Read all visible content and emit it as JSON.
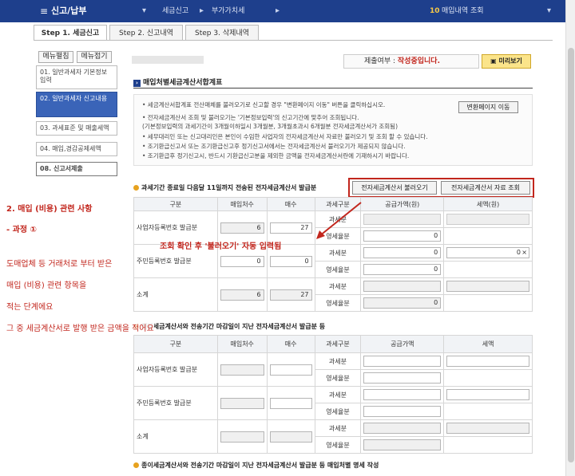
{
  "topbar": {
    "menu_icon": "hamburger-icon",
    "title": "신고/납부",
    "crumb1": "세금신고",
    "crumb2": "부가가치세",
    "badge": "10",
    "inquiry": "매입내역 조회"
  },
  "tabs": [
    "Step 1. 세금신고",
    "Step 2. 신고내역",
    "Step 3. 삭제내역"
  ],
  "sidebar": {
    "expand": "메뉴펼침",
    "collapse": "메뉴접기",
    "items": [
      "01. 일반과세자 기본정보 입력",
      "02. 일반과세자 신고내용",
      "03. 과세표준 및 매출세액",
      "04. 매입,경감공제세액",
      "08. 신고서제출"
    ]
  },
  "status": {
    "label": "제출여부 :",
    "value": "작성중입니다.",
    "preview": "미리보기"
  },
  "section1": {
    "title": "매입처별세금계산서합계표",
    "convert_button": "변환페이지 이동",
    "bullets": [
      "• 세금계산서합계표 전산매체를 불러오기로 신고할 경우 \"변환페이지 이동\" 버튼을 클릭하십시오.",
      "• 전자세금계산서 조회 및 불러오기는 '기본정보입력'의 신고기간에 맞추어 조회됩니다.",
      "   (기본정보입력의 과세기간이 3개월이하일시 3개월분, 3개월초과시 6개월분 전자세금계산서가 조회됨)",
      "• 세무대리인 또는 신고대리인은 본인이 수임한 사업자의 전자세금계산서 자료만 불러오기 및 조회 할 수 있습니다.",
      "• 조기환급신고서 또는 조기환급신고후 정기신고서에서는 전자세금계산서 불러오기가 제공되지 않습니다.",
      "• 조기환급후 정기신고시, 반드시 기환급신고분을 제외한 금액을 전자세금계산서란에 기재하시기 바랍니다."
    ]
  },
  "section2": {
    "title": "과세기간 종료일 다음달 11일까지 전송된 전자세금계산서 발급분",
    "load_button": "전자세금계산서 불러오기",
    "lookup_button": "전자세금계산서 자료 조회",
    "headers": [
      "구분",
      "매입처수",
      "매수",
      "과세구분",
      "공급가액(원)",
      "세액(원)"
    ],
    "rows": [
      {
        "label": "사업자등록번호 발급분",
        "count": "6",
        "sheets": "27",
        "sub": [
          "과세분",
          "영세율분"
        ],
        "supply": [
          "",
          "0"
        ],
        "tax": [
          ""
        ]
      },
      {
        "label": "주민등록번호 발급분",
        "count": "0",
        "sheets": "0",
        "sub": [
          "과세분",
          "영세율분"
        ],
        "supply": [
          "0",
          "0"
        ],
        "tax": [
          "0"
        ]
      },
      {
        "label": "소계",
        "count": "6",
        "sheets": "27",
        "sub": [
          "과세분",
          "영세율분"
        ],
        "supply": [
          "",
          "0"
        ],
        "tax": [
          ""
        ]
      }
    ],
    "close_icon": "x-icon"
  },
  "section3": {
    "title": "전자세금계산서와 전송기간 마감일이 지난 전자세금계산서 발급분 등",
    "headers": [
      "구분",
      "매입처수",
      "매수",
      "과세구분",
      "공급가액",
      "세액"
    ],
    "rows": [
      {
        "label": "사업자등록번호 발급분",
        "sub": [
          "과세분",
          "영세율분"
        ]
      },
      {
        "label": "주민등록번호 발급분",
        "sub": [
          "과세분",
          "영세율분"
        ]
      },
      {
        "label": "소계",
        "sub": [
          "과세분",
          "영세율분"
        ]
      }
    ]
  },
  "section4": {
    "title": "종이세금계산서와 전송기간 마감일이 지난 전자세금계산서 발급분 등 매입처별 명세 작성"
  },
  "annotations": {
    "overlay": "조회 확인 후 '불러오기' 자동 입력됨",
    "lines": [
      "2. 매입 (비용) 관련 사항",
      " - 과정 ①",
      "도매업체 등 거래처로 부터 받은",
      "매입 (비용) 관련 항목을",
      "적는 단계에요",
      "그 중 세금계산서로 발행 받은 금액을 적어요"
    ]
  },
  "colors": {
    "topbar": "#1e3f8c",
    "annotation_red": "#c2261d",
    "active_menu": "#3a64b8"
  }
}
